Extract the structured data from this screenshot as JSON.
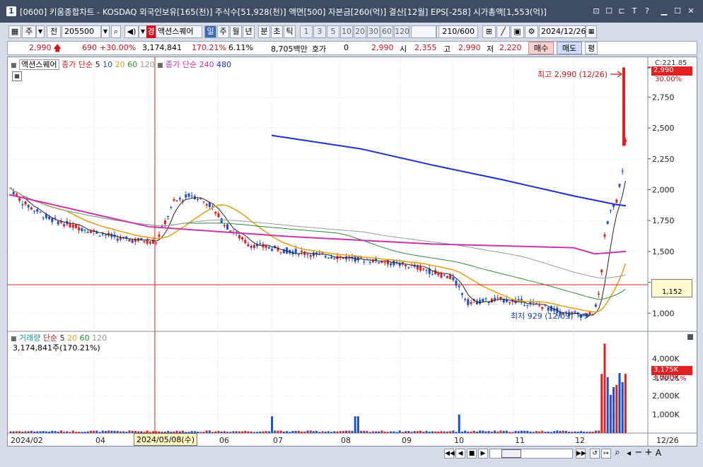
{
  "window": {
    "number": "1",
    "title": "[0600] 키움종합차트 - KOSDAQ 외국인보유[165(천)] 주식수[51,928(천)] 액면[500] 자본금[260(억)] 결산[12월] EPS[-258] 시가총액[1,553(억)]",
    "buttons": [
      "⊡",
      "☐",
      "⊏",
      "T",
      "?",
      "▭",
      "☐",
      "✕"
    ]
  },
  "toolbar": {
    "period": "주",
    "prev_label": "전",
    "code": "205500",
    "warn_label": "경",
    "name": "액션스퀘어",
    "period_tabs": [
      "일",
      "주",
      "월",
      "년",
      "분",
      "초",
      "틱"
    ],
    "active_period": "일",
    "intervals": [
      "1",
      "3",
      "5",
      "10",
      "20",
      "30",
      "60",
      "120"
    ],
    "count": "210/600",
    "date": "2024/12/26"
  },
  "quote": {
    "price": "2,990",
    "change": "690",
    "change_pct": "+30.00%",
    "volume": "3,174,841",
    "vol_ratio": "170.21%",
    "turnover": "6.11%",
    "amount": "8,705백만",
    "bid_label": "호가",
    "bid_value": "0",
    "cur": "2,990",
    "open_label": "시",
    "open": "2,355",
    "high_label": "고",
    "high": "2,990",
    "low_label": "저",
    "low": "2,220",
    "buy_label": "매수",
    "sell_label": "매도",
    "flat_label": "평"
  },
  "price_legend": {
    "name": "액션스퀘어",
    "ma1_label": "종가 단순",
    "ma1_periods": [
      "5",
      "10",
      "20",
      "60",
      "120"
    ],
    "ma2_label": "종가 단순",
    "ma2_periods": [
      "240",
      "480"
    ]
  },
  "volume_legend": {
    "label": "거래량",
    "ma_label": "단순",
    "periods": [
      "5",
      "20",
      "60",
      "120"
    ],
    "value": "3,174,841주(170.21%)"
  },
  "annotations": {
    "high": "최고 2,990 (12/26)",
    "low": "최저 929 (12/09)"
  },
  "price_axis": {
    "top_label": "C:221.85",
    "current": "2,990",
    "current_pct": "30.00%",
    "crosshair_value": "1,152",
    "ticks": [
      "2,750",
      "2,500",
      "2,250",
      "2,000",
      "1,750",
      "1,500",
      "1,250",
      "1,000"
    ]
  },
  "volume_axis": {
    "current": "3,175K",
    "current_pct": "170.21%",
    "ticks": [
      "4,000K",
      "3,000K",
      "2,000K",
      "1,000K"
    ]
  },
  "date_axis": {
    "labels": [
      "2024/02",
      "04",
      "06",
      "07",
      "08",
      "09",
      "10",
      "11",
      "12",
      "12/26"
    ],
    "crosshair_date": "2024/05/08(수)"
  },
  "colors": {
    "up": "#e02020",
    "down": "#1f4fc8",
    "ma5": "#222222",
    "ma20": "#e6a21c",
    "ma60": "#2a8a3a",
    "ma120": "#999999",
    "ma240": "#cc33aa",
    "ma480": "#1c2fcf"
  }
}
